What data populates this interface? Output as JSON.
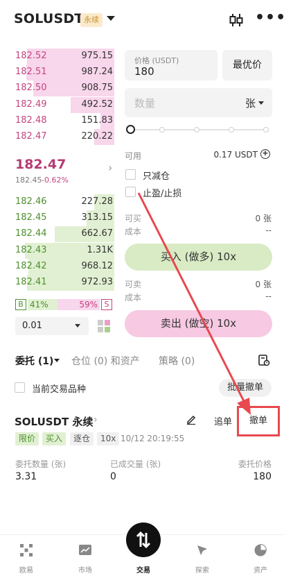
{
  "header": {
    "title": "SOLUSDT",
    "badge": "永续",
    "candle_icon": "candlestick-icon",
    "more_icon": "more-icon"
  },
  "order_book": {
    "asks": [
      {
        "price": "182.52",
        "qty": "975.15",
        "depth": 0.88
      },
      {
        "price": "182.51",
        "qty": "987.24",
        "depth": 0.89
      },
      {
        "price": "182.50",
        "qty": "908.75",
        "depth": 0.82
      },
      {
        "price": "182.49",
        "qty": "492.52",
        "depth": 0.44
      },
      {
        "price": "182.48",
        "qty": "151.83",
        "depth": 0.14
      },
      {
        "price": "182.47",
        "qty": "220.22",
        "depth": 0.2
      }
    ],
    "last_price": "182.47",
    "mark_price": "182.45",
    "change_pct": "-0.62%",
    "bids": [
      {
        "price": "182.46",
        "qty": "227.28",
        "depth": 0.2
      },
      {
        "price": "182.45",
        "qty": "313.15",
        "depth": 0.28
      },
      {
        "price": "182.44",
        "qty": "662.67",
        "depth": 0.6
      },
      {
        "price": "182.43",
        "qty": "1.31K",
        "depth": 0.9
      },
      {
        "price": "182.42",
        "qty": "968.12",
        "depth": 0.87
      },
      {
        "price": "182.41",
        "qty": "972.93",
        "depth": 0.88
      }
    ],
    "ratio": {
      "buy_label": "B",
      "buy_pct": "41%",
      "sell_pct": "59%",
      "sell_label": "S",
      "buy_fraction": 0.41
    },
    "precision": "0.01"
  },
  "order_form": {
    "price_label": "价格 (USDT)",
    "price_value": "180",
    "best_price": "最优价",
    "qty_placeholder": "数量",
    "qty_unit": "张",
    "available_label": "可用",
    "available_value": "0.17 USDT",
    "reduce_only": "只减仓",
    "tp_sl": "止盈/止损",
    "buy_can_open_label": "可买",
    "buy_can_open_value": "0 张",
    "buy_cost_label": "成本",
    "buy_cost_value": "--",
    "buy_button": "买入 (做多) 10x",
    "sell_can_open_label": "可卖",
    "sell_can_open_value": "0 张",
    "sell_cost_label": "成本",
    "sell_cost_value": "--",
    "sell_button": "卖出 (做空) 10x"
  },
  "tabs": {
    "orders": "委托 (1)",
    "positions": "仓位 (0) 和资产",
    "strategy": "策略 (0)"
  },
  "filter": {
    "current_symbol": "当前交易品种",
    "batch_cancel": "批量撤单"
  },
  "order": {
    "symbol": "SOLUSDT 永续",
    "chase": "追单",
    "cancel": "撤单",
    "tag_limit": "限价",
    "tag_buy": "买入",
    "tag_reduce": "逐仓",
    "tag_lev": "10x",
    "time": "10/12 20:19:55",
    "qty_label": "委托数量 (张)",
    "qty_value": "3.31",
    "filled_label": "已成交量 (张)",
    "filled_value": "0",
    "price_label": "委托价格",
    "price_value": "180"
  },
  "bottom_nav": {
    "items": [
      {
        "label": "欧易",
        "icon": "okx-logo-icon"
      },
      {
        "label": "市场",
        "icon": "market-chart-icon"
      },
      {
        "label": "交易",
        "icon": "trade-swap-icon"
      },
      {
        "label": "探索",
        "icon": "compass-icon"
      },
      {
        "label": "资产",
        "icon": "pie-chart-icon"
      }
    ]
  },
  "colors": {
    "annotation": "#e8484f",
    "ask": "#c2457e",
    "bid": "#4d8f2d"
  }
}
